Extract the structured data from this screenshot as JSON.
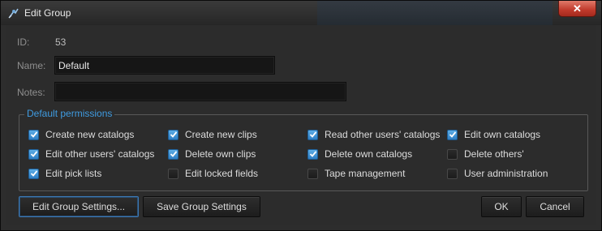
{
  "window": {
    "title": "Edit Group",
    "close_label": "✕"
  },
  "form": {
    "id_label": "ID:",
    "id_value": "53",
    "name_label": "Name:",
    "name_value": "Default",
    "notes_label": "Notes:",
    "notes_value": ""
  },
  "permissions": {
    "title": "Default permissions",
    "items": [
      {
        "label": "Create new catalogs",
        "checked": true
      },
      {
        "label": "Create new clips",
        "checked": true
      },
      {
        "label": "Read other users' catalogs",
        "checked": true
      },
      {
        "label": "Edit own catalogs",
        "checked": true
      },
      {
        "label": "Edit other users' catalogs",
        "checked": true
      },
      {
        "label": "Delete own clips",
        "checked": true
      },
      {
        "label": "Delete own catalogs",
        "checked": true
      },
      {
        "label": "Delete others'",
        "checked": false
      },
      {
        "label": "Edit pick lists",
        "checked": true
      },
      {
        "label": "Edit locked fields",
        "checked": false
      },
      {
        "label": "Tape management",
        "checked": false
      },
      {
        "label": "User administration",
        "checked": false
      }
    ]
  },
  "buttons": {
    "edit_settings": "Edit Group Settings...",
    "save_settings": "Save Group Settings",
    "ok": "OK",
    "cancel": "Cancel"
  },
  "colors": {
    "accent": "#3f9be0",
    "checkbox_on": "#2f7fc4",
    "close": "#c0392b"
  }
}
